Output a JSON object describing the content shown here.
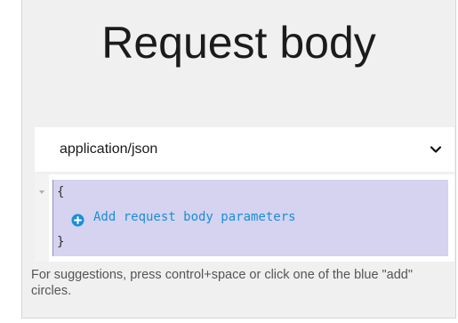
{
  "section": {
    "title": "Request body"
  },
  "content_type": {
    "selected": "application/json"
  },
  "editor": {
    "open_brace": "{",
    "add_link": "Add request body parameters",
    "close_brace": "}"
  },
  "hint": {
    "text": "For suggestions, press control+space or click one of the blue \"add\" circles."
  },
  "icons": {
    "fold": "triangle-down-icon",
    "add": "plus-circle-icon",
    "dropdown": "chevron-down-icon"
  },
  "colors": {
    "highlight": "#d5d3f0",
    "link": "#1a8fd8"
  }
}
